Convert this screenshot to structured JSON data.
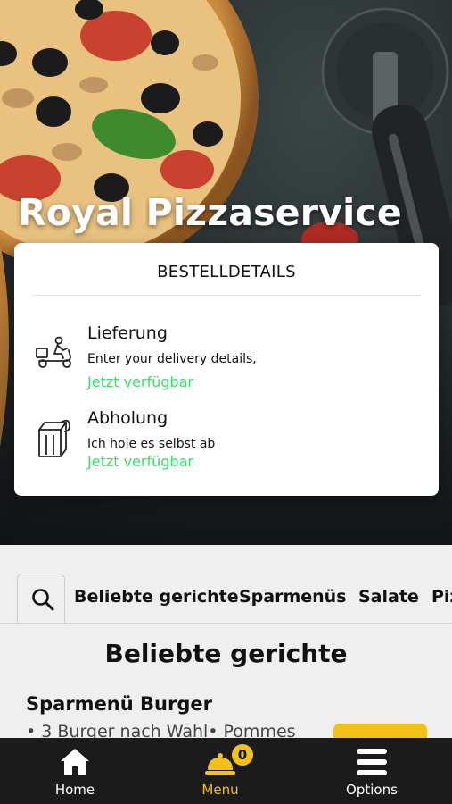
{
  "app": {
    "title": "Royal Pizzaservice"
  },
  "order_card": {
    "header": "BESTELLDETAILS",
    "options": [
      {
        "title": "Lieferung",
        "description": "Enter your delivery details,",
        "status": "Jetzt verfügbar",
        "icon": "delivery-scooter-icon"
      },
      {
        "title": "Abholung",
        "description": "Ich hole es selbst ab",
        "status": "Jetzt verfügbar",
        "icon": "takeaway-bag-icon"
      }
    ]
  },
  "categories": [
    "Beliebte gerichte",
    "Sparmenüs",
    "Salate",
    "Pizza"
  ],
  "section": {
    "title": "Beliebte gerichte"
  },
  "item": {
    "title": "Sparmenü Burger",
    "description": "• 3 Burger nach Wahl• Pommes"
  },
  "bottom_nav": {
    "items": [
      {
        "label": "Home",
        "icon": "home-icon"
      },
      {
        "label": "Menu",
        "icon": "cloche-icon"
      },
      {
        "label": "Options",
        "icon": "hamburger-menu-icon"
      }
    ],
    "cart_count": "0"
  },
  "colors": {
    "accent_yellow": "#f2c21a",
    "available_green": "#3ddc6b",
    "nav_bg": "#1b1b1b"
  }
}
